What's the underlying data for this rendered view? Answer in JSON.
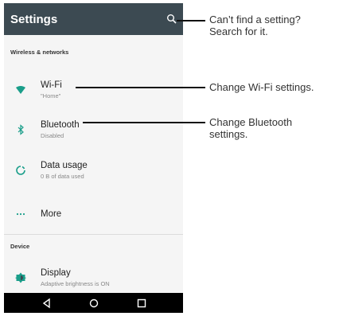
{
  "app": {
    "title": "Settings"
  },
  "sections": {
    "wireless": "Wireless & networks",
    "device": "Device"
  },
  "rows": [
    {
      "label": "Wi-Fi",
      "sub": "\"Home\"",
      "icon": "wifi-icon"
    },
    {
      "label": "Bluetooth",
      "sub": "Disabled",
      "icon": "bluetooth-icon"
    },
    {
      "label": "Data usage",
      "sub": "0 B of data used",
      "icon": "data-usage-icon"
    },
    {
      "label": "More",
      "sub": "",
      "icon": "more-icon"
    },
    {
      "label": "Display",
      "sub": "Adaptive brightness is ON",
      "icon": "brightness-icon"
    }
  ],
  "callouts": {
    "search": "Can’t find a setting? Search for it.",
    "wifi": "Change Wi-Fi settings.",
    "bluetooth": "Change Bluetooth settings."
  },
  "colors": {
    "appbar": "#3c4a52",
    "accent": "#1a9e8a",
    "navbar": "#000000"
  }
}
